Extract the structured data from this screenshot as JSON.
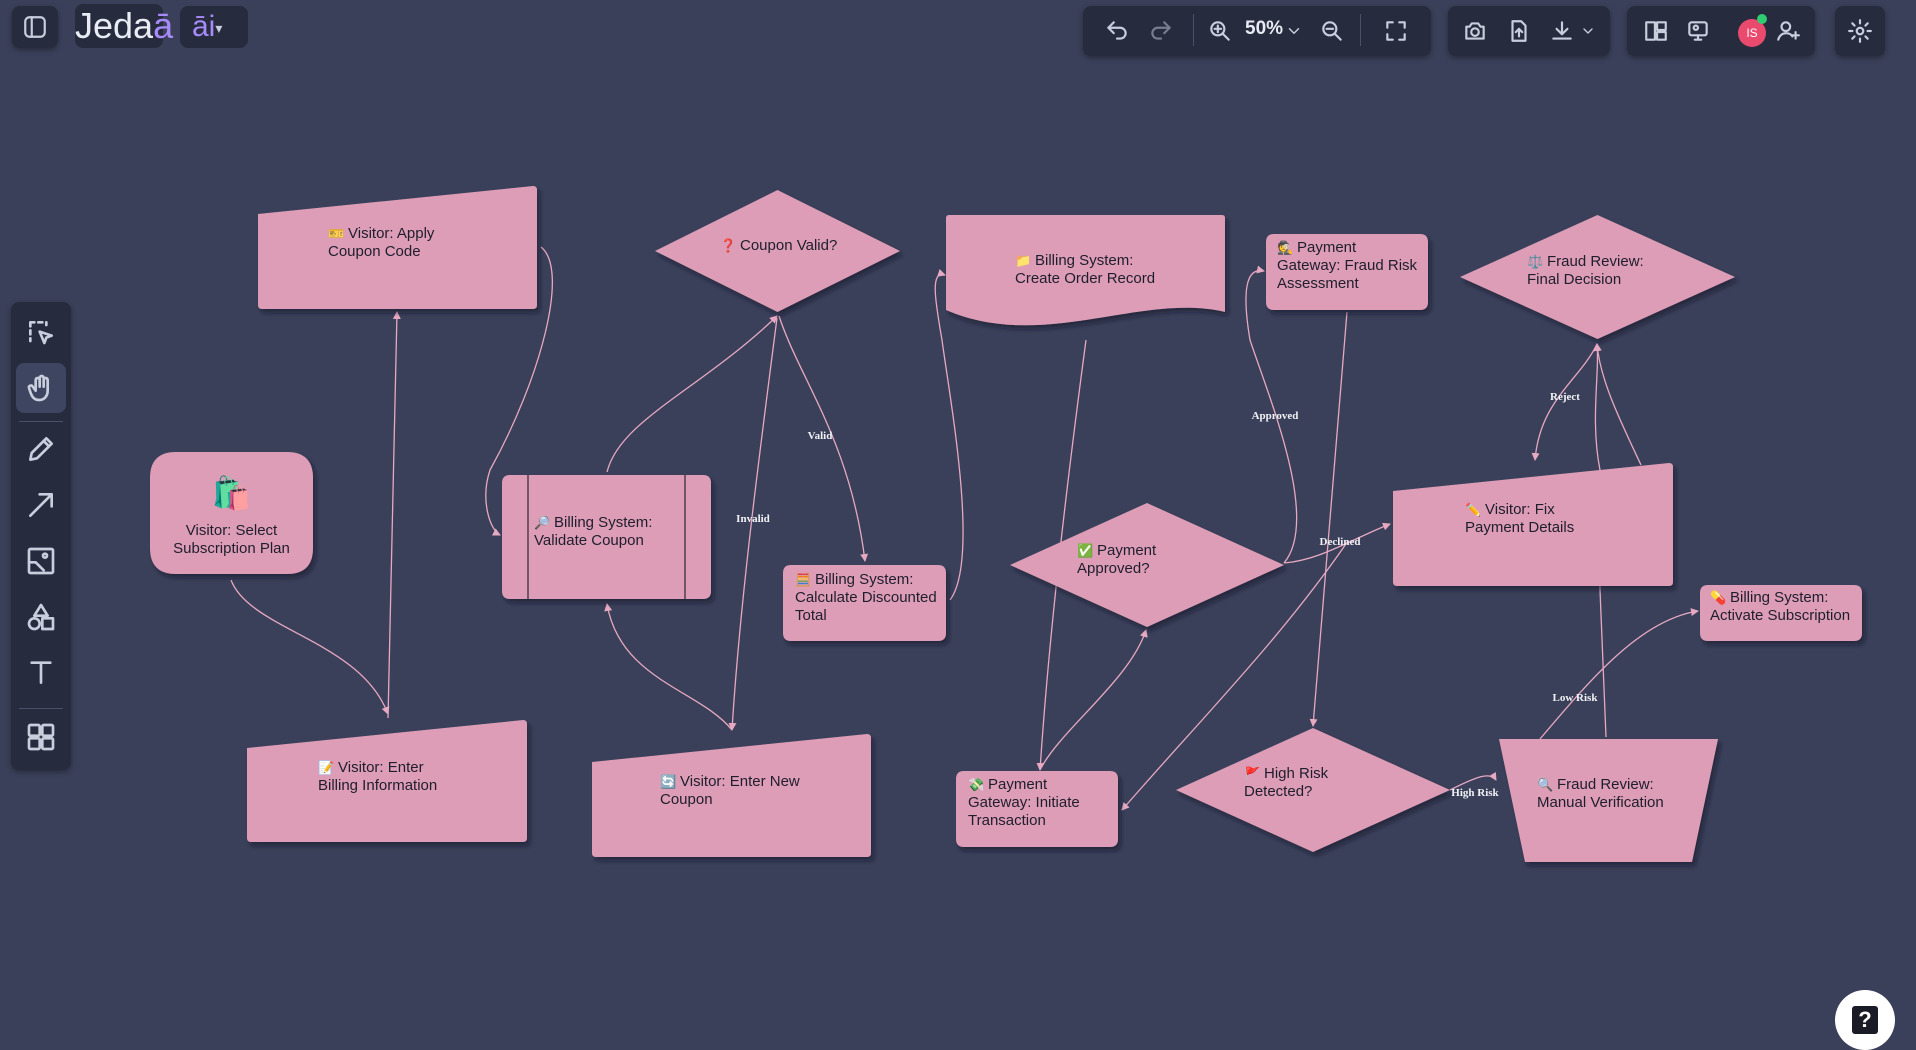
{
  "app": {
    "logo_text": "Jeda",
    "logo_accent": "ā",
    "ai_label": "āi"
  },
  "toolbar": {
    "zoom_level": "50%",
    "avatar_initials": "IS",
    "buttons": [
      "undo",
      "redo",
      "zoom-in",
      "zoom",
      "zoom-out",
      "fullscreen",
      "screenshot",
      "upload",
      "download",
      "layout",
      "present",
      "share",
      "settings"
    ]
  },
  "sidebar": {
    "tools": [
      "select",
      "hand",
      "pen",
      "arrow",
      "image",
      "shapes",
      "text",
      "templates"
    ],
    "active_tool": "hand"
  },
  "help": {
    "label": "?"
  },
  "colors": {
    "canvas_bg": "#3a4059",
    "node_fill": "#dd9db7",
    "edge": "#e7a8c2",
    "panel": "#262b3e",
    "accent": "#a78bfa"
  },
  "diagram": {
    "nodes": [
      {
        "id": "n1",
        "shape": "rounded",
        "icon": "🛍️",
        "lines": [
          "Visitor: Select",
          "Subscription Plan"
        ]
      },
      {
        "id": "n2",
        "shape": "manual-input",
        "icon": "🎫",
        "lines": [
          "Visitor: Apply",
          "Coupon Code"
        ]
      },
      {
        "id": "n3",
        "shape": "manual-input",
        "icon": "📝",
        "lines": [
          "Visitor: Enter",
          "Billing Information"
        ]
      },
      {
        "id": "n4",
        "shape": "process-bars",
        "icon": "🔎",
        "lines": [
          "Billing System:",
          "Validate Coupon"
        ]
      },
      {
        "id": "n5",
        "shape": "diamond",
        "icon": "❓",
        "lines": [
          "Coupon Valid?"
        ]
      },
      {
        "id": "n6",
        "shape": "manual-input",
        "icon": "🔄",
        "lines": [
          "Visitor: Enter New",
          "Coupon"
        ]
      },
      {
        "id": "n7",
        "shape": "rounded",
        "icon": "🧮",
        "lines": [
          "Billing System:",
          "Calculate Discounted",
          "Total"
        ]
      },
      {
        "id": "n8",
        "shape": "document",
        "icon": "📁",
        "lines": [
          "Billing System:",
          "Create Order Record"
        ]
      },
      {
        "id": "n9",
        "shape": "rounded",
        "icon": "💸",
        "lines": [
          "Payment",
          "Gateway: Initiate",
          "Transaction"
        ]
      },
      {
        "id": "n10",
        "shape": "diamond",
        "icon": "✅",
        "lines": [
          "Payment",
          "Approved?"
        ]
      },
      {
        "id": "n11",
        "shape": "rounded",
        "icon": "🕵️",
        "lines": [
          "Payment",
          "Gateway: Fraud Risk",
          "Assessment"
        ]
      },
      {
        "id": "n12",
        "shape": "diamond",
        "icon": "🚩",
        "lines": [
          "High Risk",
          "Detected?"
        ]
      },
      {
        "id": "n13",
        "shape": "manual-input",
        "icon": "✏️",
        "lines": [
          "Visitor: Fix",
          "Payment Details"
        ]
      },
      {
        "id": "n14",
        "shape": "diamond",
        "icon": "⚖️",
        "lines": [
          "Fraud Review:",
          "Final Decision"
        ]
      },
      {
        "id": "n15",
        "shape": "trapezoid",
        "icon": "🔍",
        "lines": [
          "Fraud Review:",
          "Manual Verification"
        ]
      },
      {
        "id": "n16",
        "shape": "rounded",
        "icon": "💊",
        "lines": [
          "Billing System:",
          "Activate Subscription"
        ]
      }
    ],
    "edges": [
      {
        "from": "n1",
        "to": "n3",
        "label": ""
      },
      {
        "from": "n3",
        "to": "n2",
        "label": ""
      },
      {
        "from": "n2",
        "to": "n4",
        "label": ""
      },
      {
        "from": "n4",
        "to": "n5",
        "label": ""
      },
      {
        "from": "n5",
        "to": "n7",
        "label": "Valid"
      },
      {
        "from": "n5",
        "to": "n6",
        "label": "Invalid"
      },
      {
        "from": "n6",
        "to": "n4",
        "label": ""
      },
      {
        "from": "n7",
        "to": "n8",
        "label": ""
      },
      {
        "from": "n8",
        "to": "n9",
        "label": ""
      },
      {
        "from": "n9",
        "to": "n10",
        "label": ""
      },
      {
        "from": "n10",
        "to": "n11",
        "label": "Approved"
      },
      {
        "from": "n10",
        "to": "n13",
        "label": "Declined"
      },
      {
        "from": "n13",
        "to": "n9",
        "label": ""
      },
      {
        "from": "n11",
        "to": "n12",
        "label": ""
      },
      {
        "from": "n12",
        "to": "n15",
        "label": "High Risk"
      },
      {
        "from": "n15",
        "to": "n16",
        "label": "Low Risk"
      },
      {
        "from": "n15",
        "to": "n14",
        "label": ""
      },
      {
        "from": "n14",
        "to": "n13",
        "label": "Reject"
      },
      {
        "from": "n13",
        "to": "n14",
        "label": ""
      }
    ]
  }
}
